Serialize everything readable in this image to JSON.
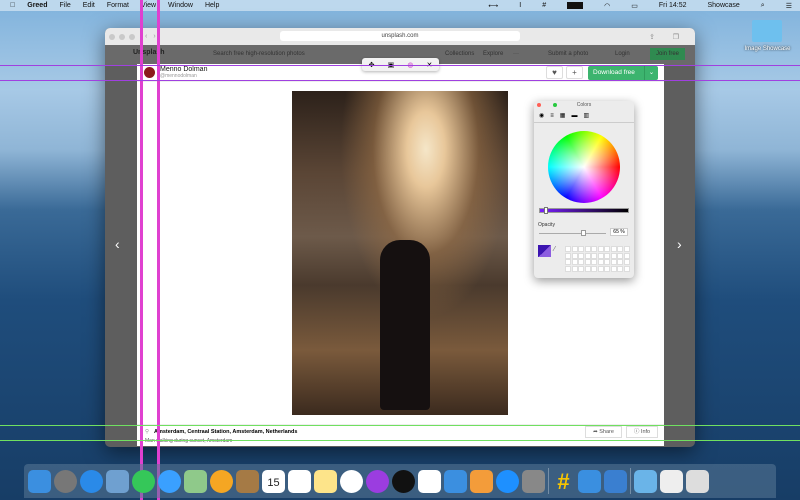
{
  "menubar": {
    "app": "Greed",
    "items": [
      "File",
      "Edit",
      "Format",
      "View",
      "Window",
      "Help"
    ],
    "clock": "Fri 14:52",
    "user": "Showcase"
  },
  "desktop": {
    "folder_label": "Image Showcase"
  },
  "browser": {
    "url": "unsplash.com",
    "site_name": "Unsplash",
    "search_placeholder": "Search free high-resolution photos",
    "nav": [
      "Collections",
      "Explore",
      "···"
    ],
    "submit": "Submit a photo",
    "login": "Login",
    "join": "Join free"
  },
  "photo_modal": {
    "author_name": "Menno Dolman",
    "author_handle": "@mennodolman",
    "download_label": "Download free",
    "location": "Amsterdam, Centraal Station, Amsterdam, Netherlands",
    "caption": "Man walking during sunset, Amsterdam",
    "share_label": "Share",
    "info_label": "Info"
  },
  "colors_panel": {
    "title": "Colors",
    "opacity_label": "Opacity",
    "opacity_value": "65 %",
    "brightness_fraction": 0.05,
    "opacity_fraction": 0.65,
    "selected_color": "#3b14b0"
  },
  "dock": {
    "apps": [
      "finder",
      "launchpad",
      "safari",
      "preview",
      "facetime",
      "messages",
      "maps",
      "photos",
      "contacts",
      "calendar",
      "reminders",
      "notes",
      "music",
      "podcasts",
      "tv",
      "numbers",
      "keynote",
      "pages",
      "app-store",
      "system-preferences",
      "greed",
      "xcode",
      "simulator",
      "downloads",
      "documents",
      "trash"
    ],
    "calendar_day": "15",
    "calendar_month": "MAY"
  }
}
